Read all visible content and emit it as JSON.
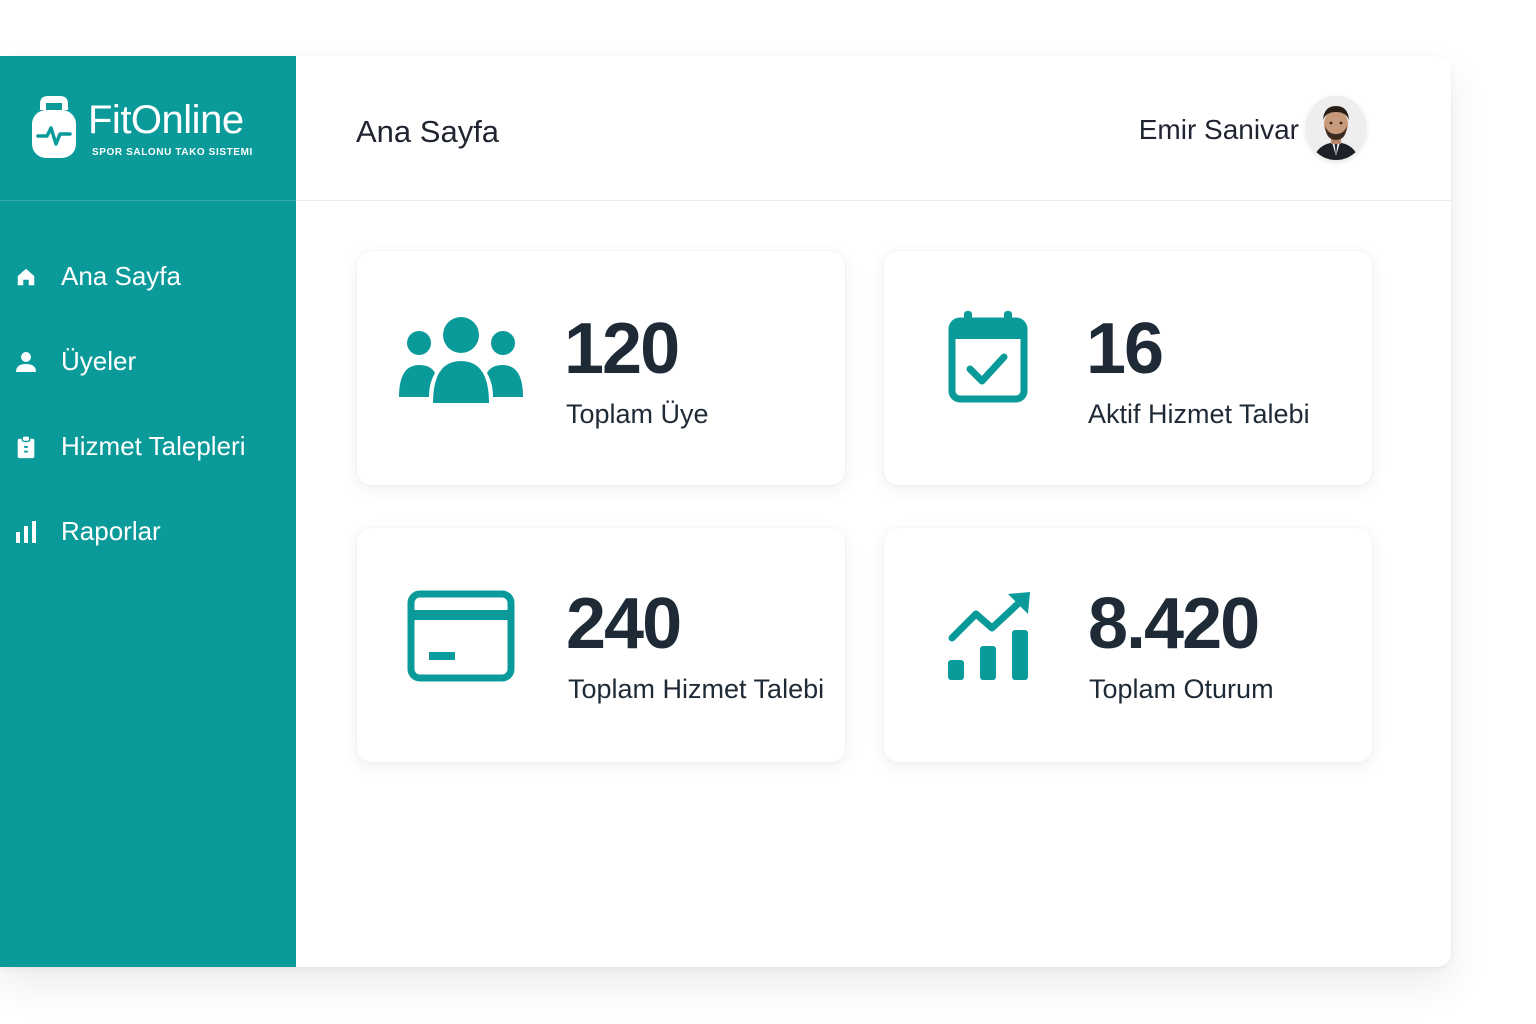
{
  "app": {
    "name": "FitOnline",
    "subtitle": "SPOR SALONU TAKO SISTEMI"
  },
  "sidebar": {
    "items": [
      {
        "label": "Ana Sayfa",
        "icon": "home-icon"
      },
      {
        "label": "Üyeler",
        "icon": "user-icon"
      },
      {
        "label": "Hizmet Talepleri",
        "icon": "clipboard-icon"
      },
      {
        "label": "Raporlar",
        "icon": "bar-chart-icon"
      }
    ]
  },
  "header": {
    "title": "Ana Sayfa",
    "user_name": "Emir Sanivar"
  },
  "stats": [
    {
      "value": "120",
      "label": "Toplam Üye",
      "icon": "users-icon"
    },
    {
      "value": "16",
      "label": "Aktif Hizmet Talebi",
      "icon": "calendar-check-icon"
    },
    {
      "value": "240",
      "label": "Toplam Hizmet Talebi",
      "icon": "credit-card-icon"
    },
    {
      "value": "8.420",
      "label": "Toplam Oturum",
      "icon": "trending-up-icon"
    }
  ],
  "colors": {
    "accent": "#0b9a9a",
    "text": "#1f2a37"
  }
}
